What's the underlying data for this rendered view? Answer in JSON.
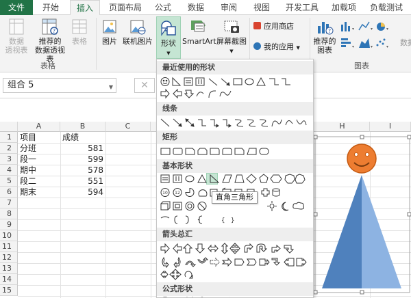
{
  "tabs": [
    "文件",
    "开始",
    "插入",
    "页面布局",
    "公式",
    "数据",
    "审阅",
    "视图",
    "开发工具",
    "加载项",
    "负载测试"
  ],
  "ribbon": {
    "pivot_table": [
      "数据",
      "透视表"
    ],
    "recommended_pivot": [
      "推荐的",
      "数据透视表"
    ],
    "table": "表格",
    "tables_group": "表格",
    "picture": "图片",
    "online_picture": "联机图片",
    "shapes": "形状",
    "smartart": "SmartArt",
    "screenshot": "屏幕截图",
    "app_store": "应用商店",
    "my_apps": "我的应用",
    "recommended_charts": [
      "推荐的",
      "图表"
    ],
    "charts_group": "图表",
    "partial_label": "数据"
  },
  "namebox": {
    "value": "组合 5"
  },
  "grid": {
    "columns": [
      "A",
      "B",
      "C",
      "H",
      "I"
    ],
    "rows": [
      "1",
      "2",
      "3",
      "4",
      "5",
      "6",
      "7",
      "8",
      "9",
      "10",
      "11",
      "12",
      "13",
      "14",
      "15"
    ],
    "table": [
      [
        "项目",
        "成绩"
      ],
      [
        "分班",
        "581"
      ],
      [
        "段一",
        "599"
      ],
      [
        "期中",
        "578"
      ],
      [
        "段二",
        "551"
      ],
      [
        "期末",
        "594"
      ]
    ]
  },
  "shapes_menu": {
    "sections": [
      "最近使用的形状",
      "线条",
      "矩形",
      "基本形状",
      "箭头总汇",
      "公式形状"
    ],
    "tooltip": "直角三角形"
  },
  "colors": {
    "excel_green": "#217346",
    "face_orange": "#ed7d31",
    "triangle_dark": "#4f81bd",
    "triangle_light": "#8db3e2"
  }
}
